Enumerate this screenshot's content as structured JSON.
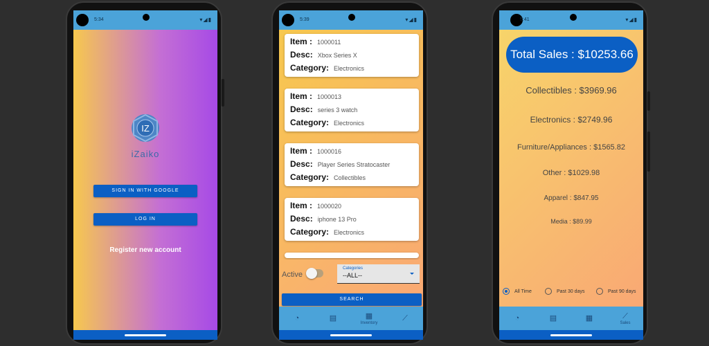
{
  "phone1": {
    "status": {
      "time": "5:34",
      "icons": "▾◢▮"
    },
    "app_name": "iZaiko",
    "logo_letters": "IZ",
    "google_button": "SIGN IN WITH GOOGLE",
    "login_button": "LOG IN",
    "register_link": "Register new account"
  },
  "phone2": {
    "status": {
      "time": "5:39",
      "icons": "▾◢▮"
    },
    "items": [
      {
        "item_label": "Item :",
        "item": "1000011",
        "desc_label": "Desc:",
        "desc": "Xbox Series X",
        "cat_label": "Category:",
        "category": "Electronics"
      },
      {
        "item_label": "Item :",
        "item": "1000013",
        "desc_label": "Desc:",
        "desc": "series 3 watch",
        "cat_label": "Category:",
        "category": "Electronics"
      },
      {
        "item_label": "Item :",
        "item": "1000016",
        "desc_label": "Desc:",
        "desc": "Player Series Stratocaster",
        "cat_label": "Category:",
        "category": "Collectibles"
      },
      {
        "item_label": "Item :",
        "item": "1000020",
        "desc_label": "Desc:",
        "desc": "iphone 13 Pro",
        "cat_label": "Category:",
        "category": "Electronics"
      }
    ],
    "active_label": "Active",
    "categories_label": "Categories",
    "categories_value": "--ALL--",
    "search_button": "SEARCH",
    "nav": [
      {
        "icon": "◔",
        "label": ""
      },
      {
        "icon": "▤",
        "label": ""
      },
      {
        "icon": "▦",
        "label": "Inventory"
      },
      {
        "icon": "⟋",
        "label": ""
      }
    ]
  },
  "phone3": {
    "status": {
      "time": "5:41",
      "icons": "▾◢▮"
    },
    "total_sales": "Total Sales : $10253.66",
    "categories": [
      "Collectibles : $3969.96",
      "Electronics : $2749.96",
      "Furniture/Appliances : $1565.82",
      "Other : $1029.98",
      "Apparel : $847.95",
      "Media : $89.99"
    ],
    "ranges": [
      "All Time",
      "Past 30 days",
      "Past 90 days"
    ],
    "selected_range": "All Time",
    "nav": [
      {
        "icon": "◔",
        "label": ""
      },
      {
        "icon": "▤",
        "label": ""
      },
      {
        "icon": "▦",
        "label": ""
      },
      {
        "icon": "⟋",
        "label": "Sales"
      }
    ]
  }
}
